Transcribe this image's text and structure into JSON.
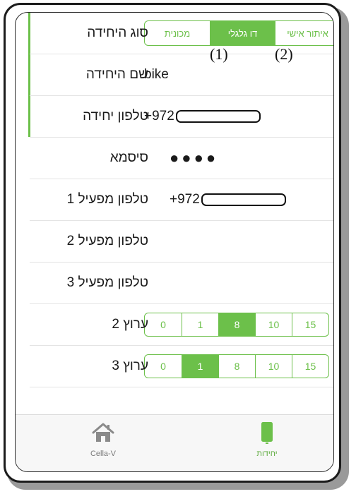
{
  "form": {
    "unit_type": {
      "label": "סוג היחידה",
      "options": [
        "מכונית",
        "דו גלגלי",
        "איתור אישי"
      ],
      "selected_index": 1
    },
    "unit_name": {
      "label": "שם היחידה",
      "value": "bike"
    },
    "unit_phone": {
      "label": "טלפון יחידה",
      "prefix": "+972"
    },
    "password": {
      "label": "סיסמא",
      "value": "●●●●"
    },
    "operator_phone_1": {
      "label": "טלפון מפעיל 1",
      "prefix": "+972"
    },
    "operator_phone_2": {
      "label": "טלפון מפעיל 2"
    },
    "operator_phone_3": {
      "label": "טלפון מפעיל 3"
    },
    "channel_2": {
      "label": "ערוץ 2",
      "options": [
        "0",
        "1",
        "8",
        "10",
        "15"
      ],
      "selected_index": 2
    },
    "channel_3": {
      "label": "ערוץ 3",
      "options": [
        "0",
        "1",
        "8",
        "10",
        "15"
      ],
      "selected_index": 1
    }
  },
  "annotations": [
    "(1)",
    "(2)"
  ],
  "tabbar": {
    "home_label": "Cella-V",
    "units_label": "יחידות"
  },
  "colors": {
    "accent": "#6cc04a"
  },
  "icons": {
    "home": "home-icon",
    "units": "phone-icon"
  }
}
